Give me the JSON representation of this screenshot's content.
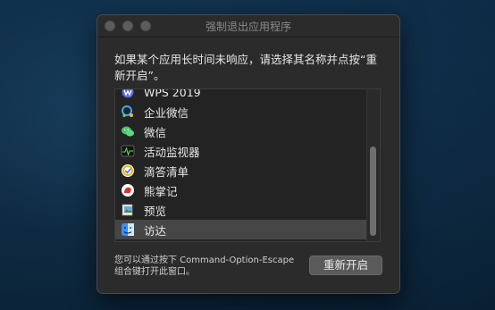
{
  "window": {
    "title": "强制退出应用程序"
  },
  "prompt": "如果某个应用长时间未响应，请选择其名称并点按“重新开启”。",
  "apps": [
    {
      "name": "WPS 2019",
      "icon": "wps-icon",
      "selected": false
    },
    {
      "name": "企业微信",
      "icon": "wecom-icon",
      "selected": false
    },
    {
      "name": "微信",
      "icon": "wechat-icon",
      "selected": false
    },
    {
      "name": "活动监视器",
      "icon": "activity-monitor-icon",
      "selected": false
    },
    {
      "name": "滴答清单",
      "icon": "ticktick-icon",
      "selected": false
    },
    {
      "name": "熊掌记",
      "icon": "bear-icon",
      "selected": false
    },
    {
      "name": "预览",
      "icon": "preview-icon",
      "selected": false
    },
    {
      "name": "访达",
      "icon": "finder-icon",
      "selected": true
    }
  ],
  "hint": "您可以通过按下 Command-Option-Escape 组合键打开此窗口。",
  "relaunch_label": "重新开启"
}
